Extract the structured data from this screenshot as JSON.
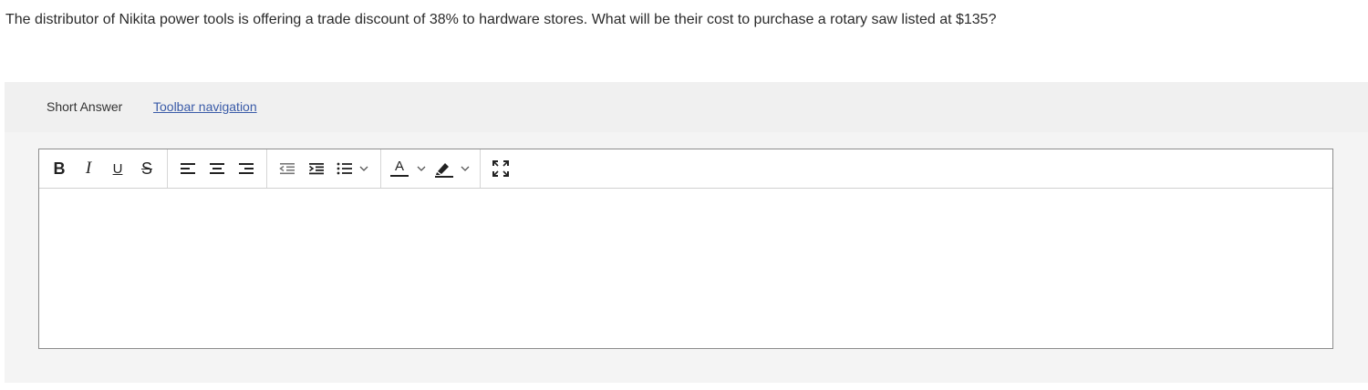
{
  "question": {
    "text": "The distributor of Nikita power tools is offering a trade discount of 38% to hardware stores. What will be their cost to purchase a rotary saw listed at $135?"
  },
  "answer_panel": {
    "type_label": "Short Answer",
    "toolbar_nav_label": "Toolbar navigation"
  },
  "toolbar": {
    "bold": "B",
    "italic": "I",
    "underline": "U",
    "strikethrough": "S",
    "icons": [
      "bold-icon",
      "italic-icon",
      "underline-icon",
      "strikethrough-icon",
      "align-left-icon",
      "align-center-icon",
      "align-right-icon",
      "outdent-icon",
      "indent-icon",
      "bullet-list-icon",
      "text-color-icon",
      "highlight-color-icon",
      "fullscreen-icon"
    ],
    "text_color_letter": "A"
  },
  "editor": {
    "value": ""
  }
}
